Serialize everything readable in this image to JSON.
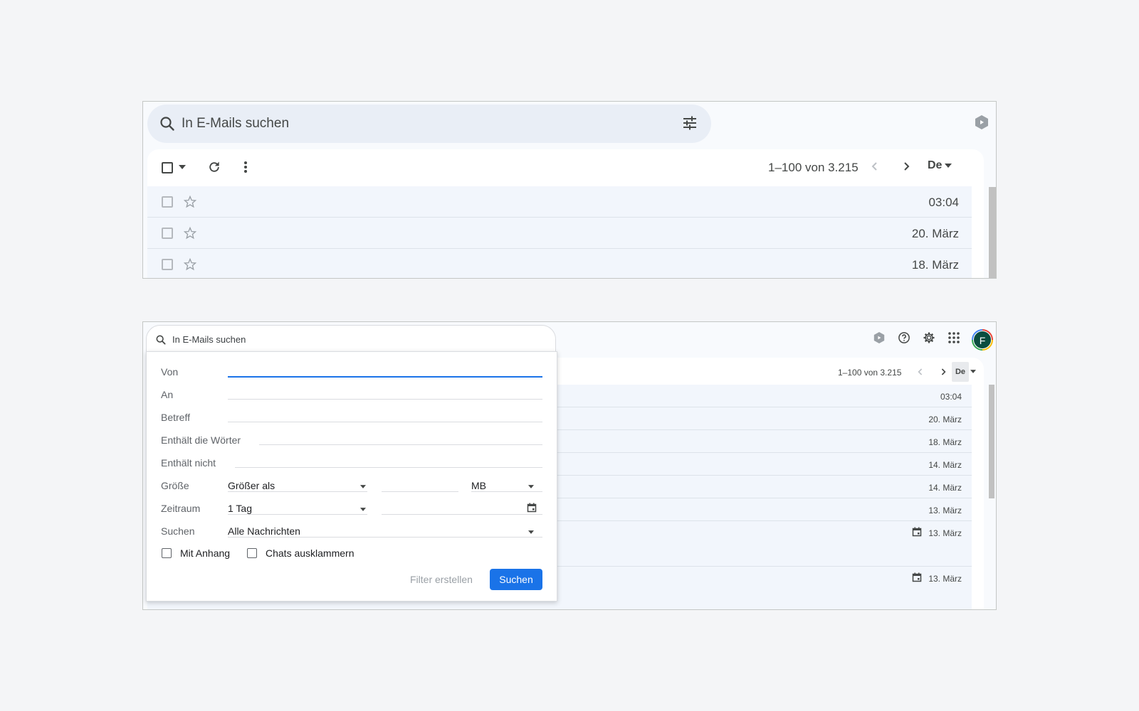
{
  "panel1": {
    "search_placeholder": "In E-Mails suchen",
    "pagination": "1–100 von 3.215",
    "input_tool": "De",
    "rows": [
      {
        "date": "03:04"
      },
      {
        "date": "20. März"
      },
      {
        "date": "18. März"
      }
    ]
  },
  "panel2": {
    "search_placeholder": "In E-Mails suchen",
    "pagination": "1–100 von 3.215",
    "input_tool": "De",
    "avatar_letter": "F",
    "rows": [
      {
        "date": "03:04"
      },
      {
        "date": "20. März"
      },
      {
        "date": "18. März"
      },
      {
        "date": "14. März"
      },
      {
        "date": "14. März"
      },
      {
        "date": "13. März"
      },
      {
        "date": "13. März"
      },
      {
        "date": "13. März"
      }
    ]
  },
  "advanced_search": {
    "from_label": "Von",
    "to_label": "An",
    "subject_label": "Betreff",
    "has_words_label": "Enthält die Wörter",
    "not_contains_label": "Enthält nicht",
    "size_label": "Größe",
    "size_operator": "Größer als",
    "size_unit": "MB",
    "date_range_label": "Zeitraum",
    "date_range_value": "1 Tag",
    "search_in_label": "Suchen",
    "search_in_value": "Alle Nachrichten",
    "has_attachment_label": "Mit Anhang",
    "exclude_chats_label": "Chats ausklammern",
    "create_filter_label": "Filter erstellen",
    "search_button_label": "Suchen"
  },
  "colors": {
    "accent": "#1a73e8",
    "row_bg": "#f2f6fc",
    "search_bg": "#e9eef6",
    "avatar_bg": "#0b4d3f"
  },
  "icons": [
    "search-icon",
    "tune-icon",
    "gemini-icon",
    "checkbox-icon",
    "chevron-down-icon",
    "refresh-icon",
    "more-vert-icon",
    "chevron-left-icon",
    "chevron-right-icon",
    "star-icon",
    "help-icon",
    "gear-icon",
    "apps-icon",
    "calendar-icon"
  ]
}
